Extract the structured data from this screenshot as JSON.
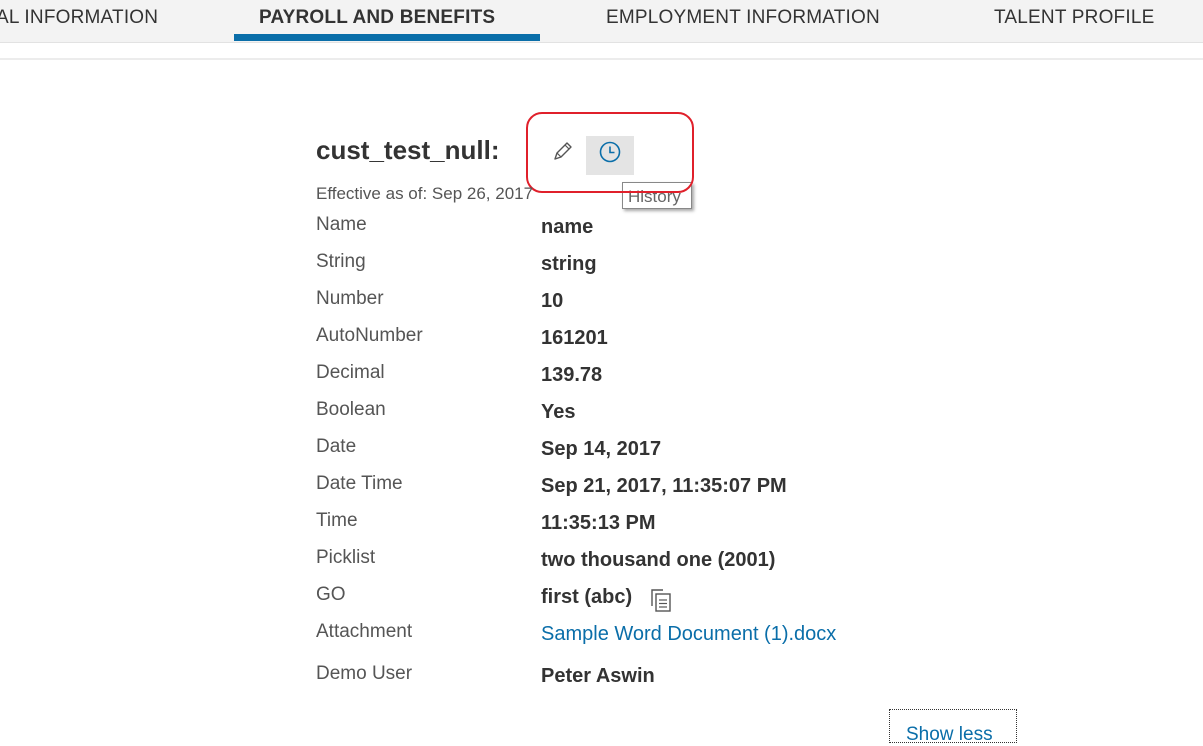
{
  "tabs": [
    {
      "label": "AL INFORMATION",
      "active": false
    },
    {
      "label": "PAYROLL AND BENEFITS",
      "active": true
    },
    {
      "label": "EMPLOYMENT INFORMATION",
      "active": false
    },
    {
      "label": "TALENT PROFILE",
      "active": false
    }
  ],
  "section": {
    "title": "cust_test_null:",
    "effective": "Effective as of: Sep 26, 2017",
    "history_tooltip": "History"
  },
  "fields": [
    {
      "label": "Name",
      "value": "name"
    },
    {
      "label": "String",
      "value": "string"
    },
    {
      "label": "Number",
      "value": "10"
    },
    {
      "label": "AutoNumber",
      "value": "161201"
    },
    {
      "label": "Decimal",
      "value": "139.78"
    },
    {
      "label": "Boolean",
      "value": "Yes"
    },
    {
      "label": "Date",
      "value": "Sep 14, 2017"
    },
    {
      "label": "Date Time",
      "value": "Sep 21, 2017, 11:35:07 PM"
    },
    {
      "label": "Time",
      "value": "11:35:13 PM"
    },
    {
      "label": "Picklist",
      "value": "two thousand one (2001)"
    },
    {
      "label": "GO",
      "value": "first (abc)"
    },
    {
      "label": "Attachment",
      "value": "Sample Word Document (1).docx"
    },
    {
      "label": "Demo User",
      "value": "Peter Aswin"
    }
  ],
  "show_less_label": "Show less",
  "colors": {
    "accent": "#0a6ea9",
    "highlight": "#e0202b"
  },
  "icons": {
    "edit": "pencil-icon",
    "history": "clock-icon",
    "go": "copy-document-icon"
  }
}
